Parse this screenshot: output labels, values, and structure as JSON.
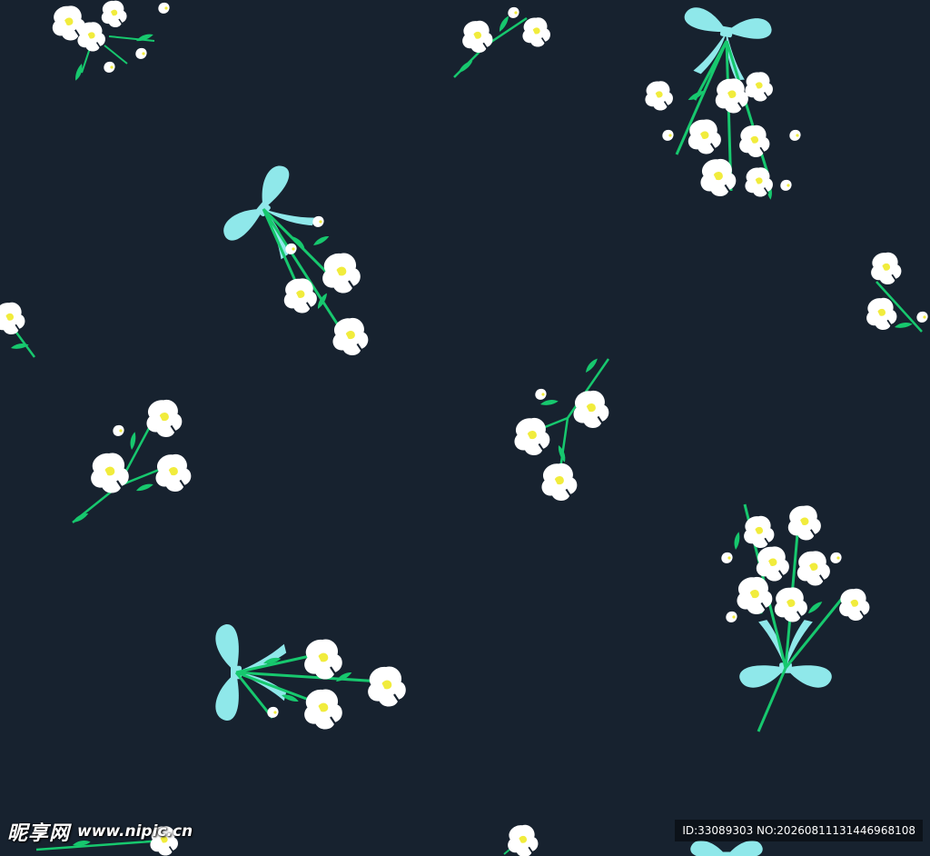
{
  "image": {
    "description_colors": {
      "background": "#17222f",
      "petal": "#ffffff",
      "leaf": "#17c86e",
      "ribbon": "#8fe8ea",
      "stamen": "#f1ec3c"
    }
  },
  "watermark": {
    "brand": "昵享网",
    "url": "www.nipic.cn",
    "id_text": "ID:33089303 NO:20260811131446968108"
  }
}
